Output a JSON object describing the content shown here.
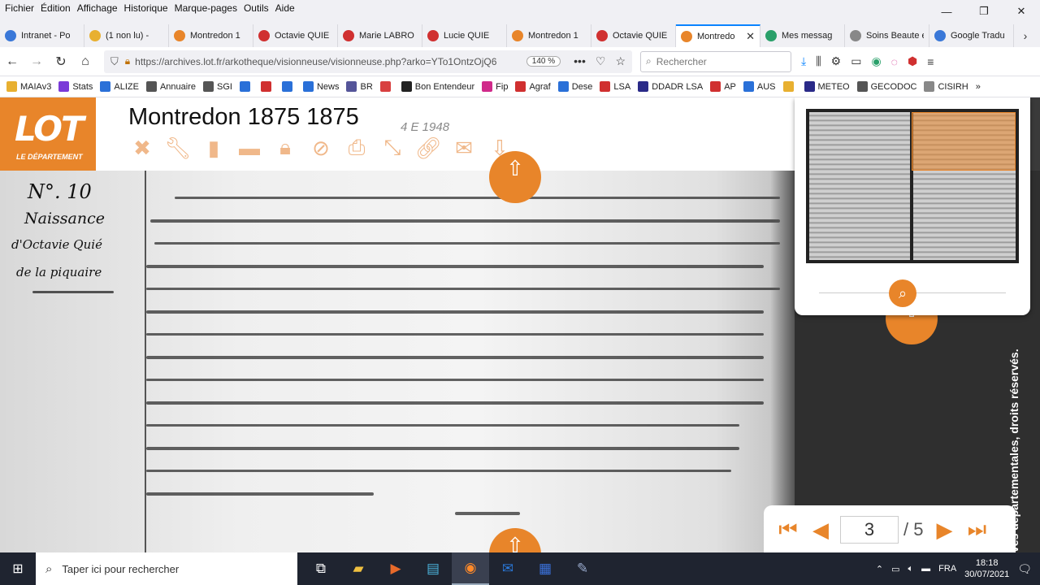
{
  "menu": [
    "Fichier",
    "Édition",
    "Affichage",
    "Historique",
    "Marque-pages",
    "Outils",
    "Aide"
  ],
  "window_controls": {
    "minimize": "—",
    "restore": "❐",
    "close": "✕"
  },
  "tabs": [
    {
      "label": "Intranet - Po",
      "icon_color": "#3a78d8"
    },
    {
      "label": "(1 non lu) - ",
      "icon_color": "#e8b030"
    },
    {
      "label": "Montredon 1",
      "icon_color": "#e8852a"
    },
    {
      "label": "Octavie QUIE",
      "icon_color": "#d03030"
    },
    {
      "label": "Marie LABRO",
      "icon_color": "#d03030"
    },
    {
      "label": "Lucie QUIE",
      "icon_color": "#d03030"
    },
    {
      "label": "Montredon 1",
      "icon_color": "#e8852a"
    },
    {
      "label": "Octavie QUIE",
      "icon_color": "#d03030"
    },
    {
      "label": "Montredo",
      "icon_color": "#e8852a",
      "active": true
    },
    {
      "label": "Mes messag",
      "icon_color": "#2aa06a"
    },
    {
      "label": "Soins Beaute et S",
      "icon_color": "#888888"
    },
    {
      "label": "Google Tradu",
      "icon_color": "#3a78d8"
    }
  ],
  "tab_close_glyph": "✕",
  "nav": {
    "back": "←",
    "forward": "→",
    "reload": "↻",
    "home": "⌂",
    "url": "https://archives.lot.fr/arkotheque/visionneuse/visionneuse.php?arko=YTo1OntzOjQ6",
    "zoom": "140 %",
    "search_placeholder": "Rechercher"
  },
  "bookmarks": [
    {
      "label": "MAIAv3",
      "color": "#e8b030"
    },
    {
      "label": "Stats",
      "color": "#7a3ad8"
    },
    {
      "label": "ALIZE",
      "color": "#2a70d8"
    },
    {
      "label": "Annuaire",
      "color": "#555555"
    },
    {
      "label": "SGI",
      "color": "#555555"
    },
    {
      "label": "",
      "color": "#2a70d8"
    },
    {
      "label": "",
      "color": "#d03030"
    },
    {
      "label": "",
      "color": "#2a70d8"
    },
    {
      "label": "News",
      "color": "#2a70d8"
    },
    {
      "label": "BR",
      "color": "#555599"
    },
    {
      "label": "",
      "color": "#d84040"
    },
    {
      "label": "Bon Entendeur",
      "color": "#222222"
    },
    {
      "label": "Fip",
      "color": "#d02a8a"
    },
    {
      "label": "Agraf",
      "color": "#d03030"
    },
    {
      "label": "Dese",
      "color": "#2a70d8"
    },
    {
      "label": "LSA",
      "color": "#d03030"
    },
    {
      "label": "DDADR LSA",
      "color": "#2a2a88"
    },
    {
      "label": "AP",
      "color": "#d03030"
    },
    {
      "label": "AUS",
      "color": "#2a70d8"
    },
    {
      "label": "",
      "color": "#e8b030"
    },
    {
      "label": "METEO",
      "color": "#2a2a88"
    },
    {
      "label": "GECODOC",
      "color": "#555555"
    },
    {
      "label": "CISIRH",
      "color": "#888888"
    }
  ],
  "viewer": {
    "logo_main": "LOT",
    "logo_sub": "LE DÉPARTEMENT",
    "title": "Montredon 1875 1875",
    "cote": "4 E 1948",
    "page_current": "3",
    "page_separator": "/ 5",
    "copyright": "ves départementales, droits réservés."
  },
  "manuscript": {
    "margin_text": [
      "N°. 10",
      "Naissance",
      "d'Octavie Quié",
      "de la piquaire"
    ]
  },
  "taskbar": {
    "search_placeholder": "Taper ici pour rechercher",
    "lang": "FRA",
    "time": "18:18",
    "date": "30/07/2021"
  }
}
